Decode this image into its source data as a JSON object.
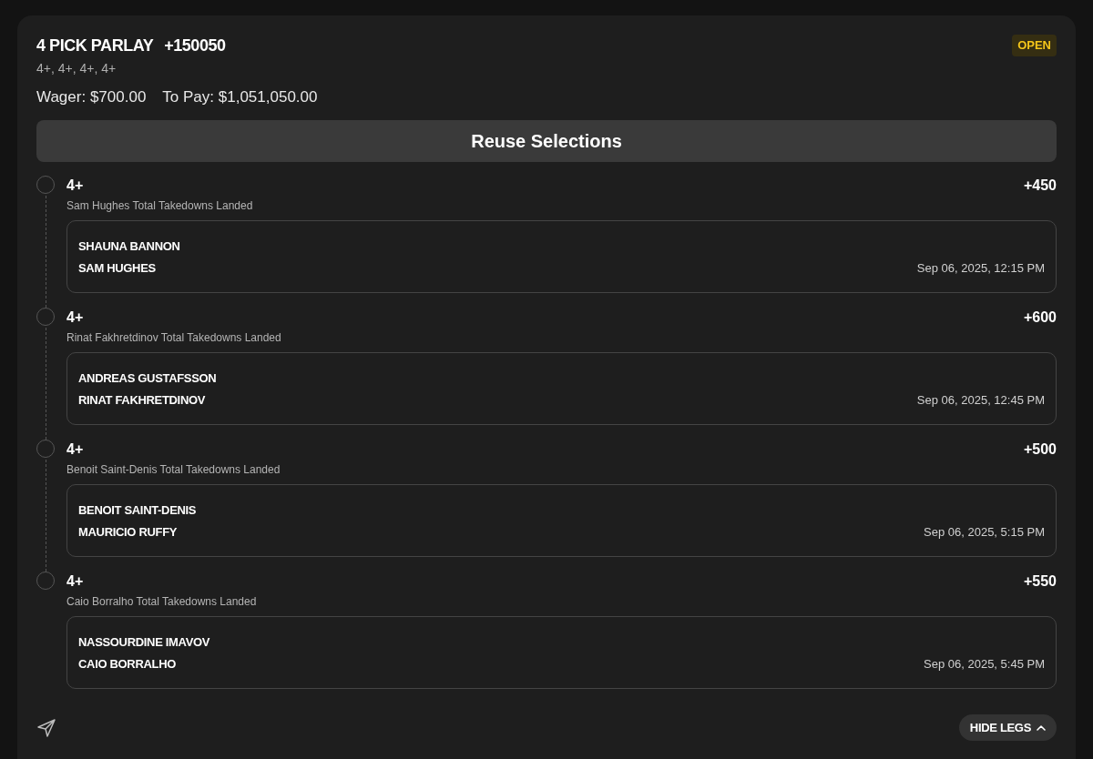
{
  "bet": {
    "title": "4 PICK PARLAY",
    "odds": "+150050",
    "status": "OPEN",
    "summary": "4+, 4+, 4+, 4+",
    "wager": "Wager: $700.00",
    "to_pay": "To Pay: $1,051,050.00"
  },
  "reuse_button": "Reuse Selections",
  "legs": [
    {
      "selection": "4+",
      "odds": "+450",
      "market": "Sam Hughes Total Takedowns Landed",
      "event": {
        "competitors": [
          "SHAUNA BANNON",
          "SAM HUGHES"
        ],
        "time": "Sep 06, 2025, 12:15 PM"
      }
    },
    {
      "selection": "4+",
      "odds": "+600",
      "market": "Rinat Fakhretdinov Total Takedowns Landed",
      "event": {
        "competitors": [
          "ANDREAS GUSTAFSSON",
          "RINAT FAKHRETDINOV"
        ],
        "time": "Sep 06, 2025, 12:45 PM"
      }
    },
    {
      "selection": "4+",
      "odds": "+500",
      "market": "Benoit Saint-Denis Total Takedowns Landed",
      "event": {
        "competitors": [
          "BENOIT SAINT-DENIS",
          "MAURICIO RUFFY"
        ],
        "time": "Sep 06, 2025, 5:15 PM"
      }
    },
    {
      "selection": "4+",
      "odds": "+550",
      "market": "Caio Borralho Total Takedowns Landed",
      "event": {
        "competitors": [
          "NASSOURDINE IMAVOV",
          "CAIO BORRALHO"
        ],
        "time": "Sep 06, 2025, 5:45 PM"
      }
    }
  ],
  "footer": {
    "toggle_button": "HIDE LEGS",
    "expanded": true
  }
}
